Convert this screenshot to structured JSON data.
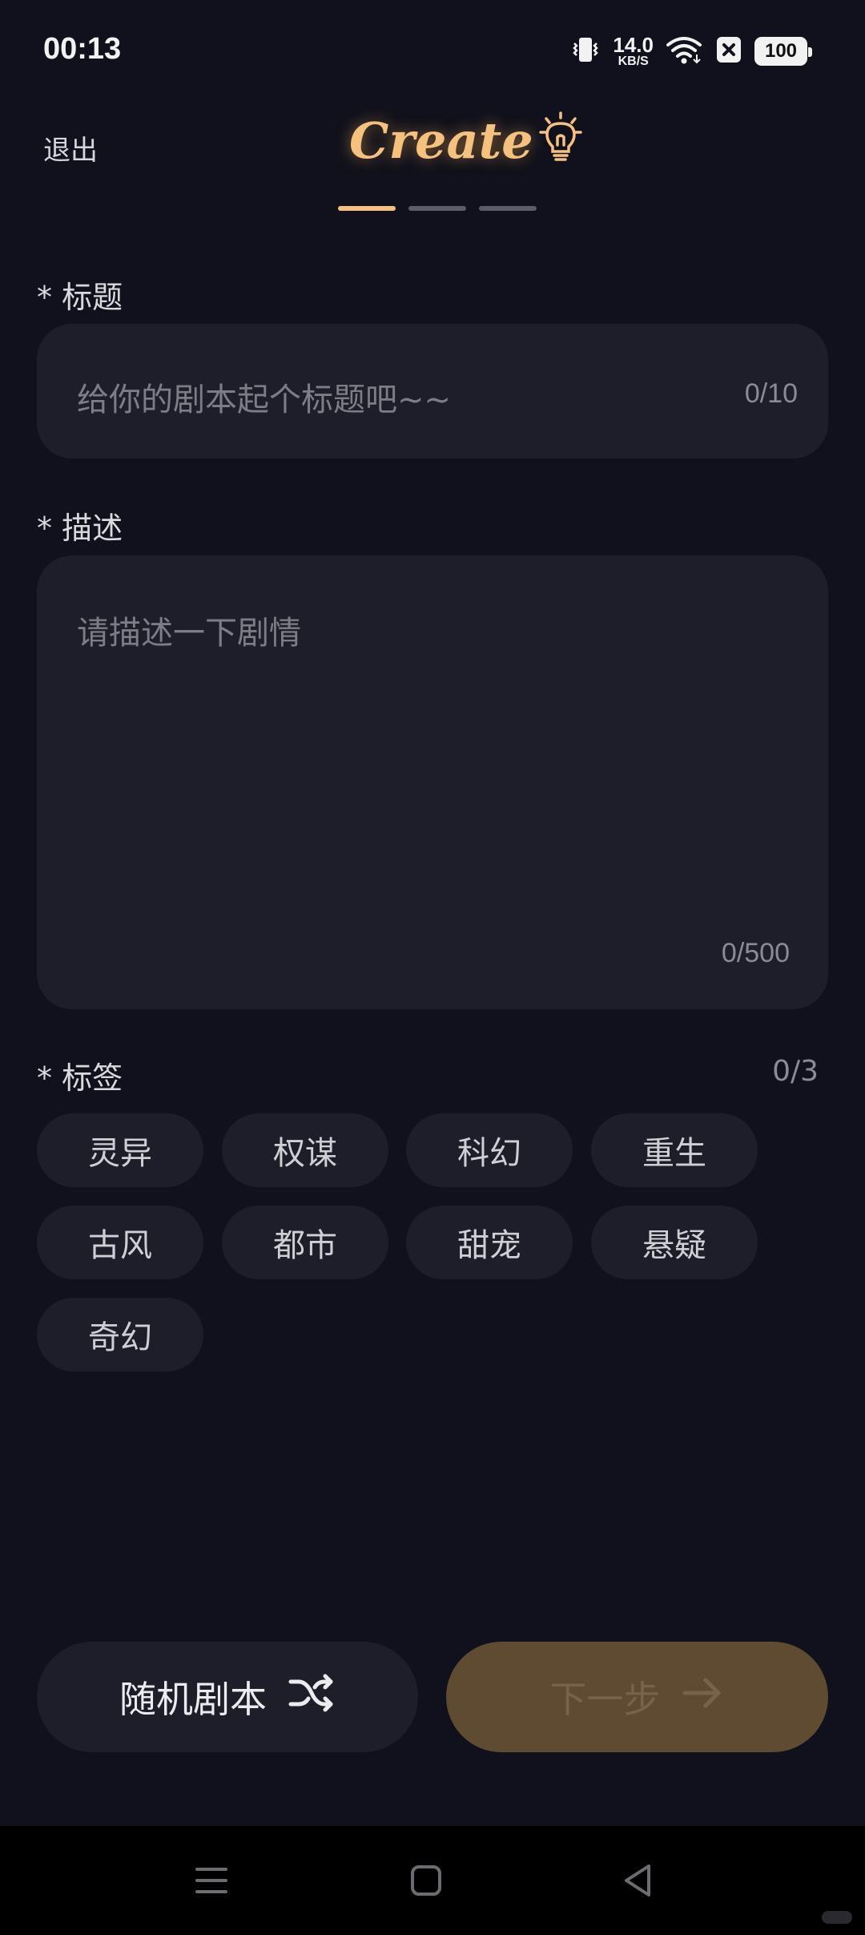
{
  "status_bar": {
    "time": "00:13",
    "net_speed_value": "14.0",
    "net_speed_unit": "KB/S",
    "battery": "100"
  },
  "header": {
    "exit_label": "退出",
    "logo_text": "Create",
    "steps_total": 3,
    "current_step": 1
  },
  "form": {
    "title": {
      "label": "* 标题",
      "placeholder": "给你的剧本起个标题吧~~",
      "counter": "0/10"
    },
    "description": {
      "label": "* 描述",
      "placeholder": "请描述一下剧情",
      "counter": "0/500"
    },
    "tags": {
      "label": "* 标签",
      "counter": "0/3",
      "items": [
        "灵异",
        "权谋",
        "科幻",
        "重生",
        "古风",
        "都市",
        "甜宠",
        "悬疑",
        "奇幻"
      ]
    }
  },
  "actions": {
    "random_label": "随机剧本",
    "next_label": "下一步"
  },
  "colors": {
    "background": "#10111c",
    "field_bg": "#1d1e29",
    "accent": "#f5c27e",
    "next_button_bg": "#5e4b31"
  }
}
